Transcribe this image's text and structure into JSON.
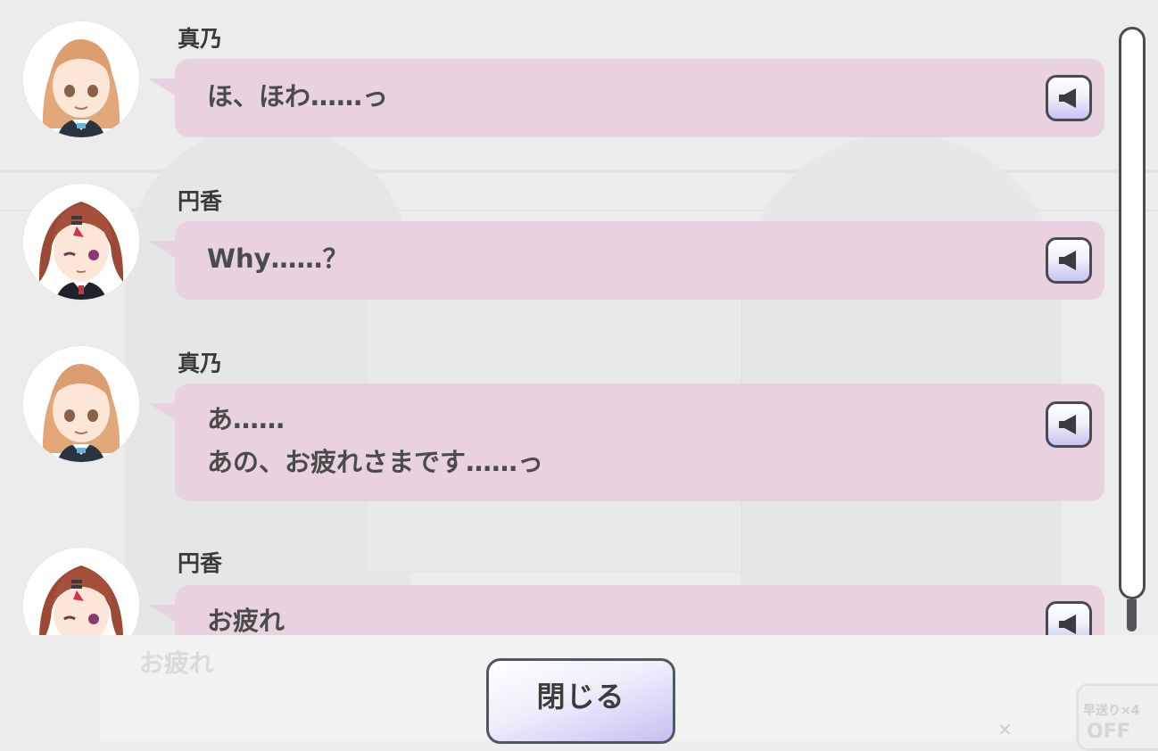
{
  "accent_colors": {
    "bubble": "#e8d2df",
    "button_gradient_end": "#c6bff2",
    "outline": "#4a4a50"
  },
  "log": [
    {
      "speaker": "真乃",
      "avatar_icon": "mano-avatar-icon",
      "lines": [
        "ほ、ほわ……っ"
      ],
      "voice_icon": "speaker-icon"
    },
    {
      "speaker": "円香",
      "avatar_icon": "madoka-avatar-icon",
      "lines": [
        "Why……？"
      ],
      "voice_icon": "speaker-icon"
    },
    {
      "speaker": "真乃",
      "avatar_icon": "mano-avatar-icon",
      "lines": [
        "あ……",
        "あの、お疲れさまです……っ"
      ],
      "voice_icon": "speaker-icon"
    },
    {
      "speaker": "円香",
      "avatar_icon": "madoka-avatar-icon",
      "lines": [
        "お疲れ"
      ],
      "voice_icon": "speaker-icon"
    }
  ],
  "close_button": {
    "label": "閉じる"
  },
  "background": {
    "ghost_text": "お疲れ",
    "skip_label": "早送り×4",
    "skip_state": "OFF"
  }
}
